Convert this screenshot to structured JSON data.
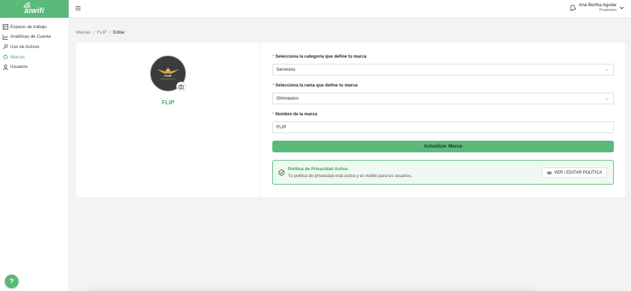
{
  "app": {
    "logo_text": "aiwifi"
  },
  "sidebar": {
    "items": [
      {
        "label": "Espacio de trabajo",
        "icon": "workspace-icon",
        "active": false
      },
      {
        "label": "Analíticas de Cuenta",
        "icon": "chart-icon",
        "active": false
      },
      {
        "label": "Uso de Activos",
        "icon": "key-icon",
        "active": false
      },
      {
        "label": "Marcas",
        "icon": "tag-icon",
        "active": true
      },
      {
        "label": "Usuarios",
        "icon": "user-icon",
        "active": false
      }
    ],
    "help_label": "?"
  },
  "header": {
    "user_name": "Ana Bertha Aguilar",
    "user_role": "Propietario"
  },
  "breadcrumb": {
    "items": [
      "Marcas",
      "FLIP",
      "Editar"
    ],
    "separator": "/"
  },
  "brand": {
    "name": "FLIP",
    "logo_text": "FLIP"
  },
  "form": {
    "category_label": "Selecciona la categoría que define tu marca",
    "category_value": "Servicios",
    "branch_label": "Selecciona la rama que define tu marca",
    "branch_value": "Gimnasios",
    "name_label": "Nombre de la marca",
    "name_value": "FLIP",
    "required_mark": "*",
    "submit_label": "Actualizar Marca"
  },
  "policy": {
    "title": "Política de Privacidad Activa",
    "description": "Tu política de privacidad está activa y es visible para los usuarios.",
    "button_label": "VER / EDITAR POLÍTICA"
  },
  "colors": {
    "brand_green": "#5bb97a",
    "accent_text_green": "#4aa66a",
    "required_red": "#e04646"
  }
}
